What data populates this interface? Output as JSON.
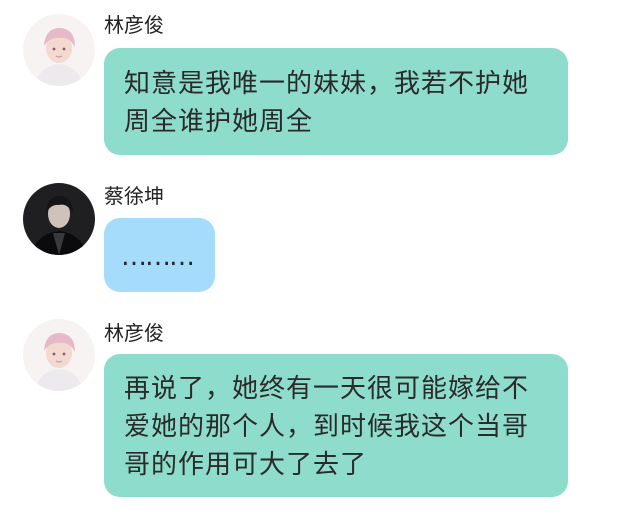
{
  "conversation": {
    "messages": [
      {
        "sender": "林彦俊",
        "avatar_icon": "avatar-light-icon",
        "bubble_color": "#8edccb",
        "text": "知意是我唯一的妹妹，我若不护她\n周全谁护她周全"
      },
      {
        "sender": "蔡徐坤",
        "avatar_icon": "avatar-dark-icon",
        "bubble_color": "#a6dcfb",
        "text": "………"
      },
      {
        "sender": "林彦俊",
        "avatar_icon": "avatar-light-icon",
        "bubble_color": "#8edccb",
        "text": "再说了，她终有一天很可能嫁给不\n爱她的那个人，到时候我这个当哥\n哥的作用可大了去了"
      }
    ]
  }
}
